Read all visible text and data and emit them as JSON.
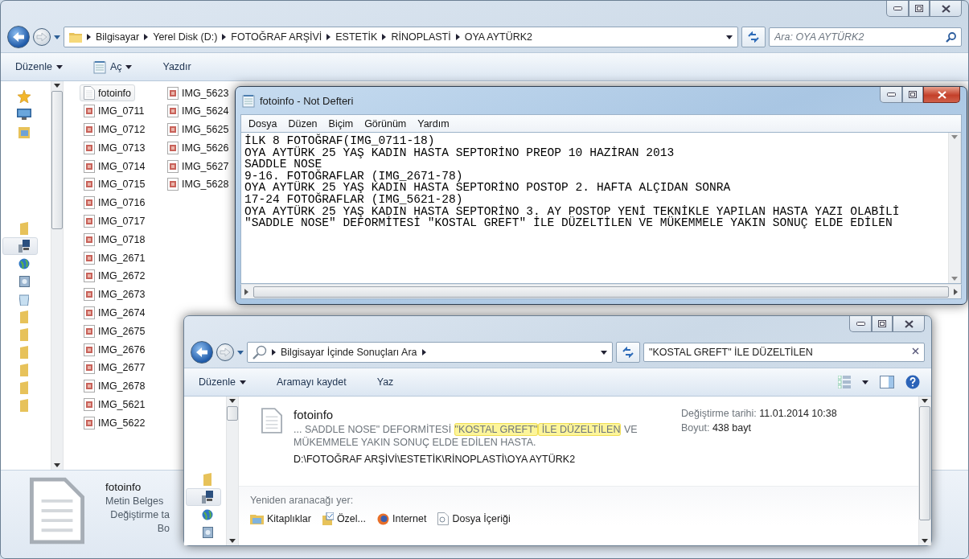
{
  "explorer": {
    "active": false,
    "breadcrumb": [
      "Bilgisayar",
      "Yerel Disk (D:)",
      "FOTOĞRAF ARŞİVİ",
      "ESTETİK",
      "RİNOPLASTİ",
      "OYA AYTÜRK2"
    ],
    "search": {
      "placeholder": "Ara: OYA AYTÜRK2"
    },
    "toolbar": [
      {
        "label": "Düzenle",
        "kind": "dropdown"
      },
      {
        "label": "Aç",
        "kind": "app-dropdown"
      },
      {
        "label": "Yazdır",
        "kind": "plain"
      }
    ],
    "nav_sections": [
      [
        {
          "kind": "star",
          "selected": false
        },
        {
          "kind": "monitor",
          "selected": false
        },
        {
          "kind": "picture-folder",
          "selected": false
        }
      ],
      [
        {
          "kind": "folder",
          "selected": false
        },
        {
          "kind": "computer",
          "selected": true
        },
        {
          "kind": "globe",
          "selected": false
        },
        {
          "kind": "drive",
          "selected": false
        },
        {
          "kind": "bin",
          "selected": false
        },
        {
          "kind": "folder",
          "selected": false
        },
        {
          "kind": "folder",
          "selected": false
        },
        {
          "kind": "folder",
          "selected": false
        },
        {
          "kind": "folder",
          "selected": false
        },
        {
          "kind": "folder",
          "selected": false
        },
        {
          "kind": "folder",
          "selected": false
        }
      ]
    ],
    "files": [
      {
        "name": "fotoinfo",
        "kind": "text",
        "selected": true
      },
      {
        "name": "IMG_0711",
        "kind": "image",
        "selected": false
      },
      {
        "name": "IMG_0712",
        "kind": "image",
        "selected": false
      },
      {
        "name": "IMG_0713",
        "kind": "image",
        "selected": false
      },
      {
        "name": "IMG_0714",
        "kind": "image",
        "selected": false
      },
      {
        "name": "IMG_0715",
        "kind": "image",
        "selected": false
      },
      {
        "name": "IMG_0716",
        "kind": "image",
        "selected": false
      },
      {
        "name": "IMG_0717",
        "kind": "image",
        "selected": false
      },
      {
        "name": "IMG_0718",
        "kind": "image",
        "selected": false
      },
      {
        "name": "IMG_2671",
        "kind": "image",
        "selected": false
      },
      {
        "name": "IMG_2672",
        "kind": "image",
        "selected": false
      },
      {
        "name": "IMG_2673",
        "kind": "image",
        "selected": false
      },
      {
        "name": "IMG_2674",
        "kind": "image",
        "selected": false
      },
      {
        "name": "IMG_2675",
        "kind": "image",
        "selected": false
      },
      {
        "name": "IMG_2676",
        "kind": "image",
        "selected": false
      },
      {
        "name": "IMG_2677",
        "kind": "image",
        "selected": false
      },
      {
        "name": "IMG_2678",
        "kind": "image",
        "selected": false
      },
      {
        "name": "IMG_5621",
        "kind": "image",
        "selected": false
      },
      {
        "name": "IMG_5622",
        "kind": "image",
        "selected": false
      },
      {
        "name": "IMG_5623",
        "kind": "image",
        "selected": false
      },
      {
        "name": "IMG_5624",
        "kind": "image",
        "selected": false
      },
      {
        "name": "IMG_5625",
        "kind": "image",
        "selected": false
      },
      {
        "name": "IMG_5626",
        "kind": "image",
        "selected": false
      },
      {
        "name": "IMG_5627",
        "kind": "image",
        "selected": false
      },
      {
        "name": "IMG_5628",
        "kind": "image",
        "selected": false
      }
    ],
    "details": {
      "name": "fotoinfo",
      "type": "Metin Belges",
      "labels": [
        "Değiştirme ta",
        "Bo"
      ]
    }
  },
  "notepad": {
    "active": true,
    "title": "fotoinfo - Not Defteri",
    "menu": [
      "Dosya",
      "Düzen",
      "Biçim",
      "Görünüm",
      "Yardım"
    ],
    "lines": [
      "İLK 8 FOTOĞRAF(IMG_0711-18)",
      "OYA AYTÜRK 25 YAŞ KADIN HASTA SEPTORİNO PREOP 10 HAZİRAN 2013",
      "SADDLE NOSE",
      "9-16. FOTOĞRAFLAR (IMG_2671-78)",
      "OYA AYTÜRK 25 YAŞ KADIN HASTA SEPTORİNO POSTOP 2. HAFTA ALÇIDAN SONRA",
      "17-24 FOTOĞRAFLAR (IMG_5621-28)",
      "OYA AYTÜRK 25 YAŞ KADIN HASTA SEPTORİNO 3. AY POSTOP YENİ TEKNİKLE YAPILAN HASTA YAZI OLABİLİ",
      "\"SADDLE NOSE\" DEFORMİTESİ \"KOSTAL GREFT\" İLE DÜZELTİLEN VE MÜKEMMELE YAKIN SONUÇ ELDE EDİLEN"
    ]
  },
  "search_window": {
    "active": false,
    "breadcrumb": [
      "Bilgisayar İçinde Sonuçları Ara"
    ],
    "search": {
      "value": "\"KOSTAL GREFT\" İLE DÜZELTİLEN"
    },
    "toolbar": [
      {
        "label": "Düzenle",
        "kind": "dropdown"
      },
      {
        "label": "Aramayı kaydet",
        "kind": "plain"
      },
      {
        "label": "Yaz",
        "kind": "plain"
      }
    ],
    "nav": [
      {
        "kind": "folder",
        "selected": false
      },
      {
        "kind": "computer",
        "selected": true
      },
      {
        "kind": "globe",
        "selected": false
      },
      {
        "kind": "drive",
        "selected": false
      }
    ],
    "result": {
      "name": "fotoinfo",
      "snippet": [
        {
          "text": "... SADDLE NOSE\" DEFORMİTESİ ",
          "highlighted": false
        },
        {
          "text": "\"KOSTAL GREFT\"",
          "highlighted": true
        },
        {
          "text": " İLE DÜZELTİLEN",
          "highlighted": true
        },
        {
          "text": " VE MÜKEMMELE YAKIN SONUÇ ELDE EDİLEN HASTA.",
          "highlighted": false
        }
      ],
      "path": "D:\\FOTOĞRAF ARŞİVİ\\ESTETİK\\RİNOPLASTİ\\OYA AYTÜRK2",
      "meta": [
        {
          "label": "Değiştirme tarihi:",
          "value": "11.01.2014 10:38"
        },
        {
          "label": "Boyut:",
          "value": "438 bayt"
        }
      ]
    },
    "search_again": {
      "label": "Yeniden aranacağı yer:",
      "locations": [
        {
          "label": "Kitaplıklar",
          "kind": "library"
        },
        {
          "label": "Özel...",
          "kind": "custom"
        },
        {
          "label": "Internet",
          "kind": "browser"
        },
        {
          "label": "Dosya İçeriği",
          "kind": "document"
        }
      ]
    }
  }
}
